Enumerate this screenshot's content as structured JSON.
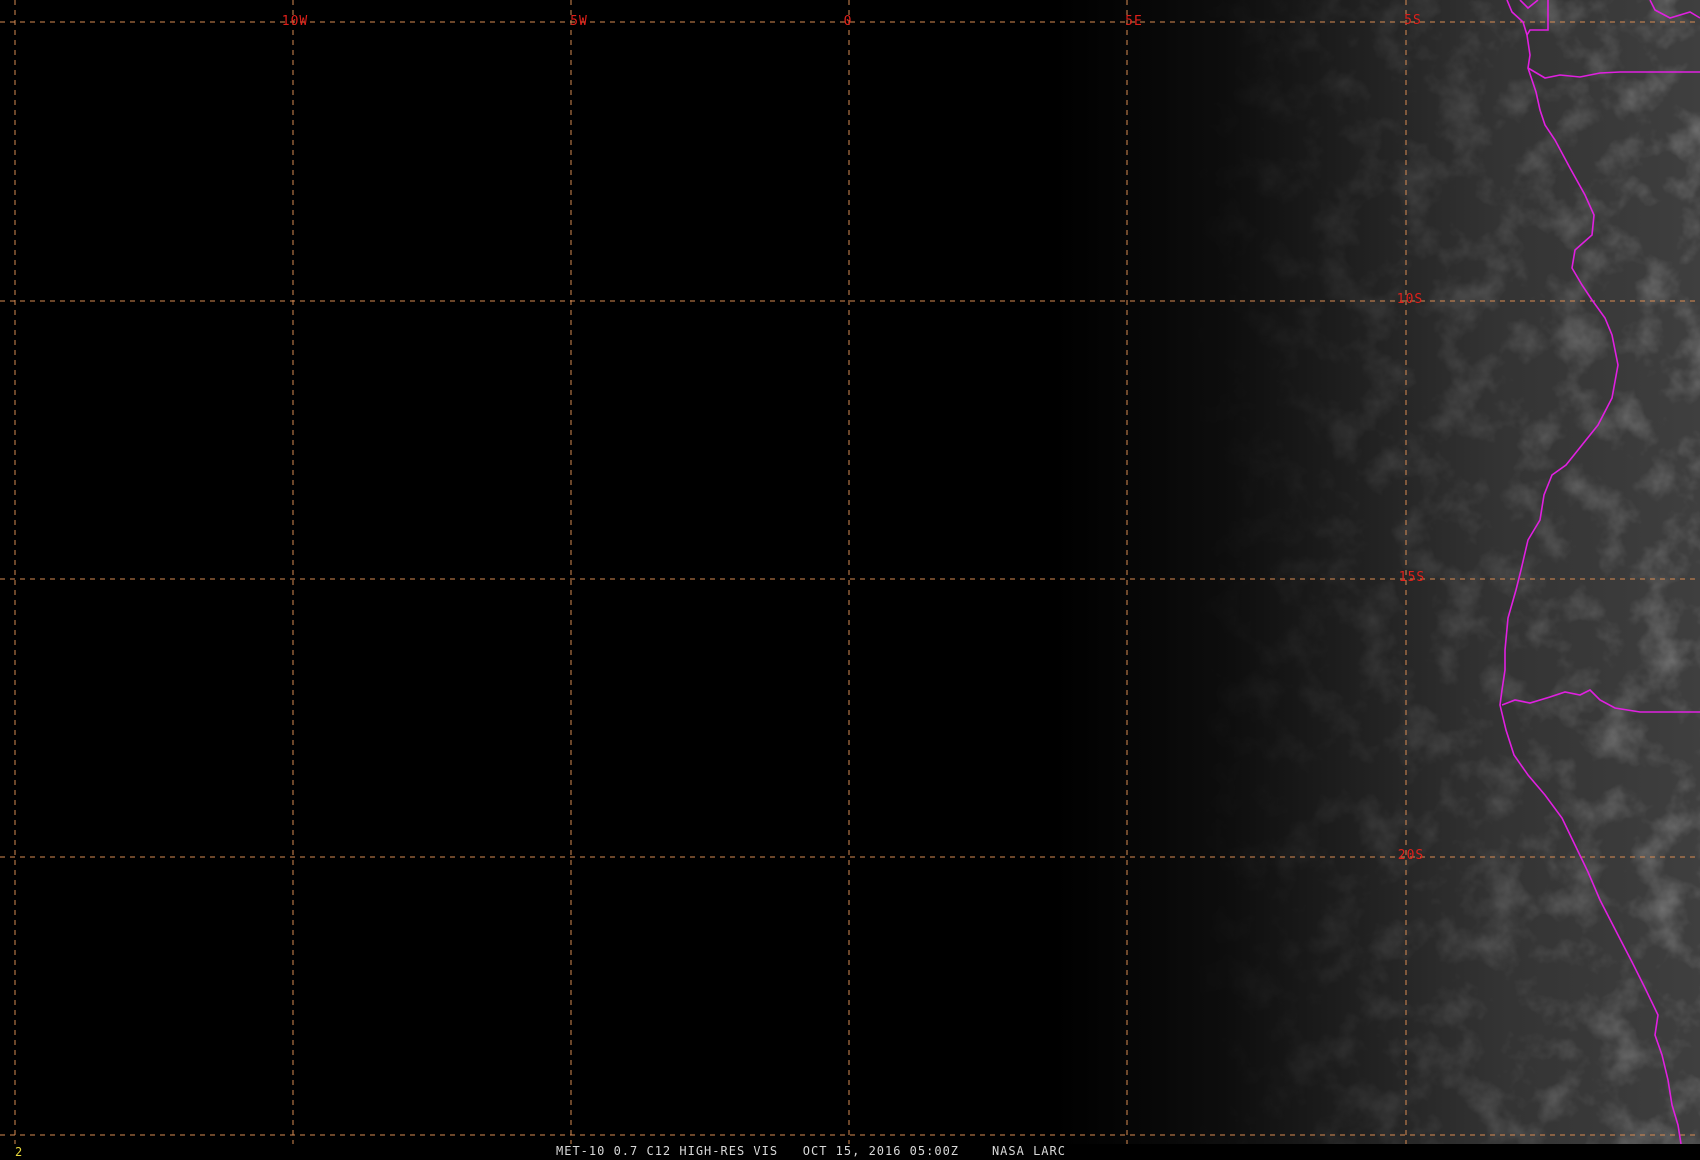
{
  "map": {
    "longitude_labels": [
      "10W",
      "5W",
      "0",
      "5E"
    ],
    "latitude_labels": [
      "5S",
      "10S",
      "15S",
      "20S"
    ],
    "colors": {
      "grid": "#d98c52",
      "labels": "#e0201a",
      "borders": "#e020e0",
      "frame_number": "#e8d83a",
      "caption": "#d8d8d8"
    }
  },
  "footer": {
    "frame_number": "2",
    "satellite": "MET-10 0.7 C12 HIGH-RES VIS",
    "datetime": "OCT 15, 2016 05:00Z",
    "source": "NASA LARC"
  }
}
